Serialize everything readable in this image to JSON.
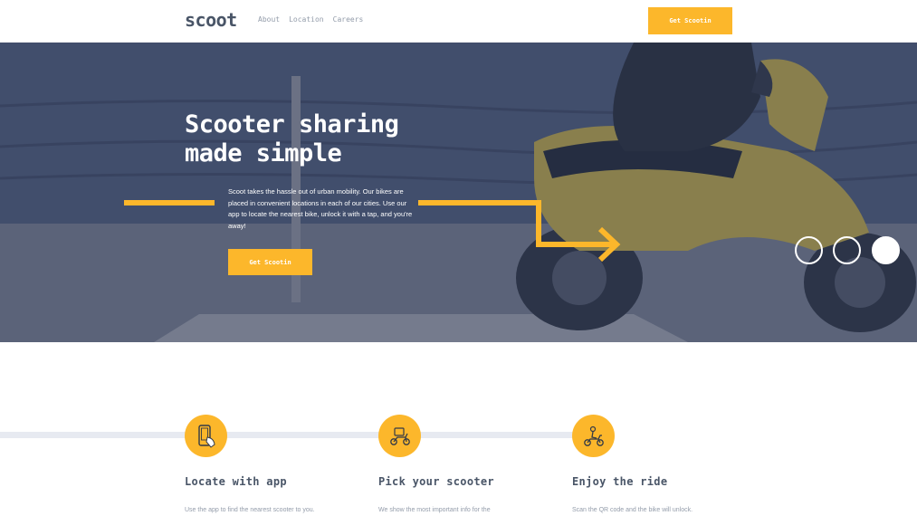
{
  "header": {
    "logo": "scoot",
    "nav": [
      "About",
      "Location",
      "Careers"
    ],
    "cta_label": "Get Scootin"
  },
  "hero": {
    "title_line1": "Scooter sharing",
    "title_line2": "made simple",
    "lead": "Scoot takes the hassle out of urban mobility. Our bikes are placed in convenient locations in each of our cities. Use our app to locate the nearest bike, unlock it with a tap, and you're away!",
    "cta_label": "Get Scootin",
    "carousel": {
      "slides": 3,
      "active_index": 2
    }
  },
  "steps": [
    {
      "title": "Locate with app",
      "desc": "Use the app to find the nearest scooter to you.",
      "icon": "phone-locate-icon"
    },
    {
      "title": "Pick your scooter",
      "desc": "We show the most important info for the",
      "icon": "scooter-icon"
    },
    {
      "title": "Enjoy the ride",
      "desc": "Scan the QR code and the bike will unlock.",
      "icon": "ride-icon"
    }
  ],
  "colors": {
    "accent": "#fcb72b",
    "text_dark": "#495567",
    "text_muted": "#939caa",
    "line": "#e7eaf1"
  }
}
